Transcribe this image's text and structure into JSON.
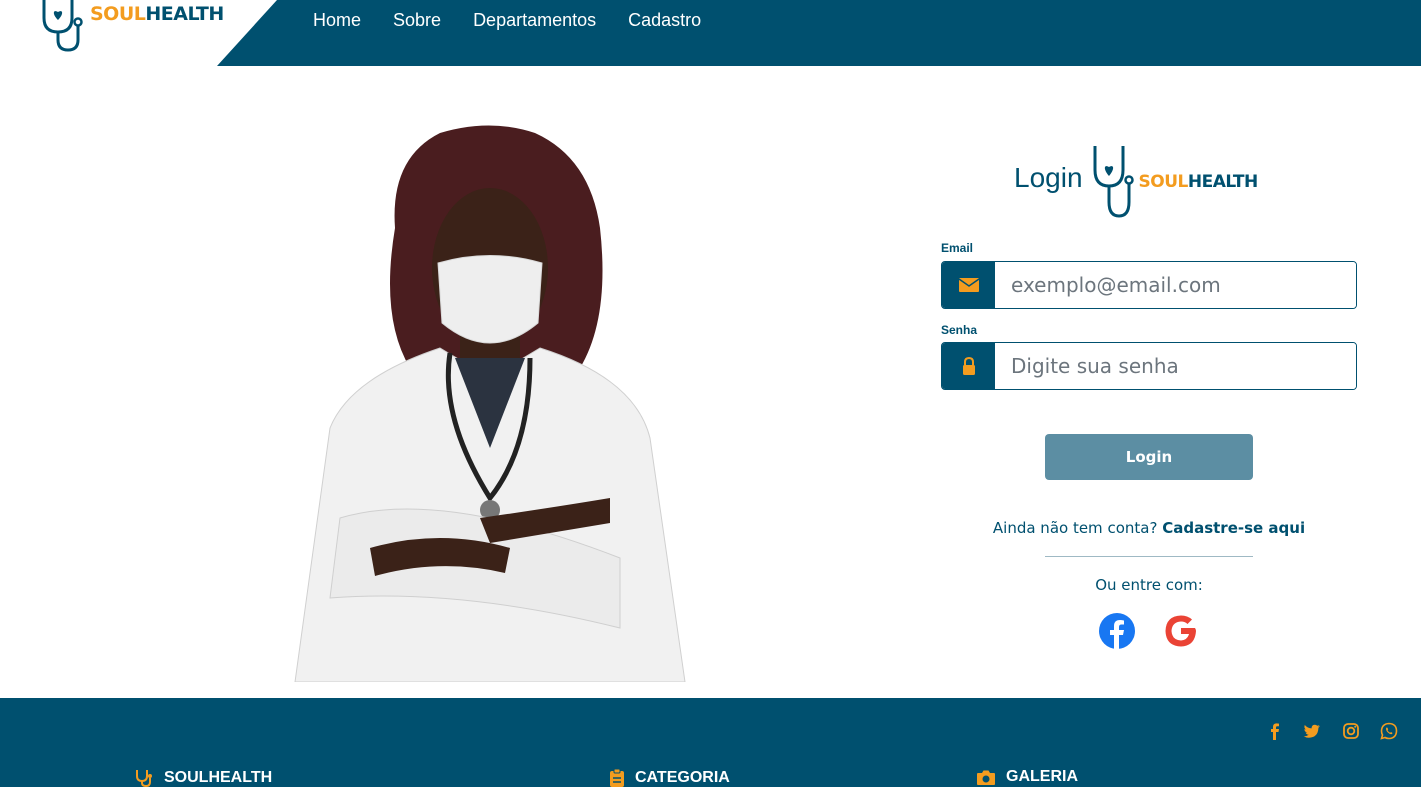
{
  "header": {
    "logo": {
      "soul": "SOUL",
      "health": "HEALTH"
    },
    "nav": [
      "Home",
      "Sobre",
      "Departamentos",
      "Cadastro"
    ]
  },
  "login": {
    "title": "Login",
    "logo": {
      "soul": "SOUL",
      "health": "HEALTH"
    },
    "email_label": "Email",
    "email_placeholder": "exemplo@email.com",
    "password_label": "Senha",
    "password_placeholder": "Digite sua senha",
    "submit_label": "Login",
    "no_account_text": "Ainda não tem conta?",
    "signup_link": "Cadastre-se aqui",
    "or_text": "Ou entre com:",
    "social": [
      "facebook-icon",
      "google-icon"
    ]
  },
  "footer": {
    "social_icons": [
      "facebook-icon",
      "twitter-icon",
      "instagram-icon",
      "whatsapp-icon"
    ],
    "columns": [
      "SOULHEALTH",
      "CATEGORIA",
      "GALERIA"
    ]
  },
  "colors": {
    "primary": "#00506f",
    "accent": "#f39c1f",
    "button": "#5c8ea3"
  }
}
